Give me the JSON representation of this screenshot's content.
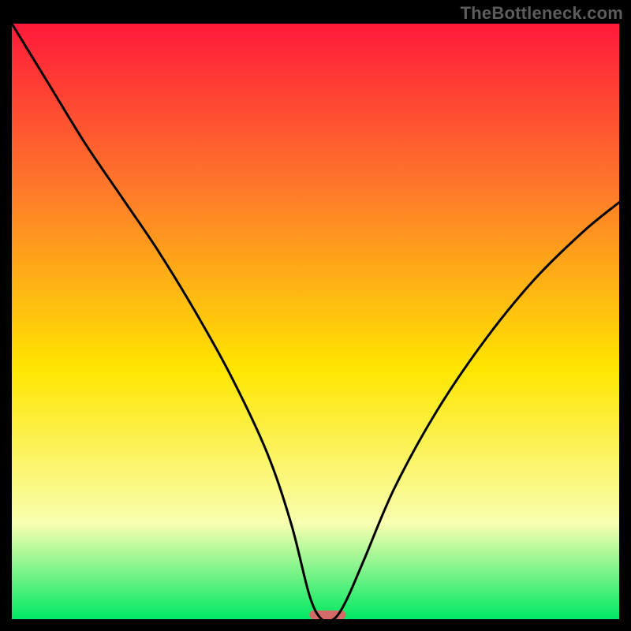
{
  "watermark": "TheBottleneck.com",
  "chart_data": {
    "type": "line",
    "title": "",
    "xlabel": "",
    "ylabel": "",
    "xlim": [
      0,
      100
    ],
    "ylim": [
      0,
      100
    ],
    "grid": false,
    "legend": false,
    "background_gradient": {
      "top": "#ff1a3a",
      "mid_upper": "#ff7a2a",
      "mid": "#ffe600",
      "lower": "#f8ffb0",
      "bottom": "#00e862"
    },
    "marker": {
      "x": 52,
      "y": 0,
      "width": 6,
      "color": "#d46a6a"
    },
    "series": [
      {
        "name": "bottleneck-curve",
        "x": [
          0,
          6,
          12,
          18,
          24,
          30,
          36,
          42,
          46,
          49,
          51,
          53,
          55,
          58,
          63,
          70,
          78,
          86,
          94,
          100
        ],
        "y": [
          100,
          90,
          80,
          71,
          62,
          52,
          41,
          28,
          16,
          4,
          0,
          0,
          3,
          10,
          22,
          35,
          47,
          57,
          65,
          70
        ]
      }
    ]
  }
}
